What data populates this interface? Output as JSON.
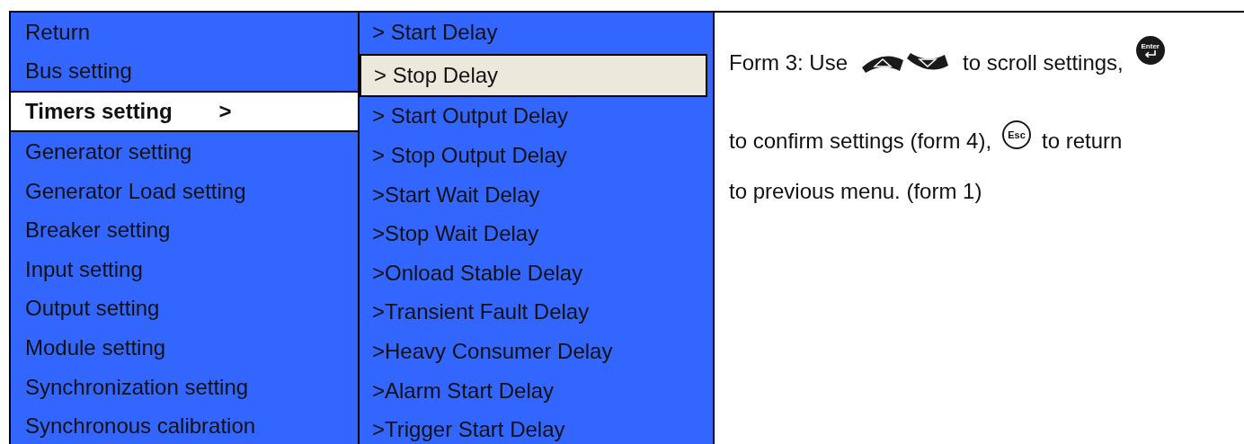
{
  "main_menu": {
    "items": [
      {
        "label": "Return",
        "selected": false
      },
      {
        "label": "Bus setting",
        "selected": false
      },
      {
        "label": "Timers setting",
        "selected": true,
        "suffix": ">"
      },
      {
        "label": "Generator setting",
        "selected": false
      },
      {
        "label": "Generator Load setting",
        "selected": false
      },
      {
        "label": "Breaker setting",
        "selected": false
      },
      {
        "label": "Input setting",
        "selected": false
      },
      {
        "label": "Output setting",
        "selected": false
      },
      {
        "label": "Module setting",
        "selected": false
      },
      {
        "label": "Synchronization setting",
        "selected": false
      },
      {
        "label": "Synchronous calibration",
        "selected": false
      }
    ]
  },
  "sub_menu": {
    "items": [
      {
        "label": "> Start Delay",
        "selected": false
      },
      {
        "label": "> Stop Delay",
        "selected": true
      },
      {
        "label": "> Start Output Delay",
        "selected": false
      },
      {
        "label": "> Stop Output Delay",
        "selected": false
      },
      {
        "label": ">Start Wait Delay",
        "selected": false
      },
      {
        "label": ">Stop Wait Delay",
        "selected": false
      },
      {
        "label": ">Onload Stable Delay",
        "selected": false
      },
      {
        "label": ">Transient Fault Delay",
        "selected": false
      },
      {
        "label": ">Heavy Consumer Delay",
        "selected": false
      },
      {
        "label": ">Alarm Start Delay",
        "selected": false
      },
      {
        "label": ">Trigger Start Delay",
        "selected": false
      }
    ]
  },
  "instructions": {
    "lines": [
      [
        {
          "kind": "text",
          "text": "Form 3: Use"
        },
        {
          "kind": "up-key"
        },
        {
          "kind": "down-key"
        },
        {
          "kind": "text",
          "text": "to scroll settings,"
        },
        {
          "kind": "enter-key",
          "text": "Enter"
        }
      ],
      [
        {
          "kind": "text",
          "text": "to confirm settings (form 4),"
        },
        {
          "kind": "esc-key",
          "text": "Esc"
        },
        {
          "kind": "text",
          "text": "to return"
        }
      ],
      [
        {
          "kind": "text",
          "text": "to previous menu. (form 1)"
        }
      ]
    ]
  }
}
